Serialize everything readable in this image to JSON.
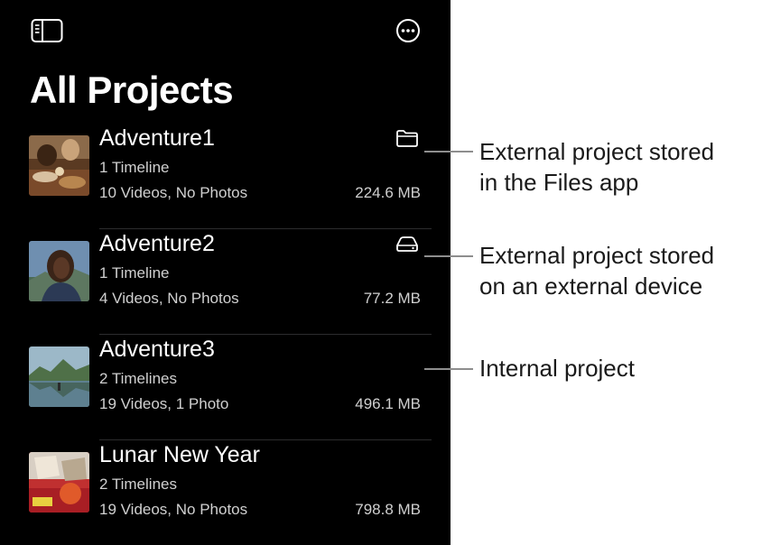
{
  "header": {
    "title": "All Projects",
    "sidebar_icon": "sidebar-toggle-icon",
    "more_icon": "ellipsis-circle-icon"
  },
  "projects": [
    {
      "name": "Adventure1",
      "timelines": "1 Timeline",
      "media": "10 Videos, No Photos",
      "size": "224.6 MB",
      "storage_icon": "folder-icon"
    },
    {
      "name": "Adventure2",
      "timelines": "1 Timeline",
      "media": "4 Videos, No Photos",
      "size": "77.2 MB",
      "storage_icon": "external-drive-icon"
    },
    {
      "name": "Adventure3",
      "timelines": "2 Timelines",
      "media": "19 Videos, 1 Photo",
      "size": "496.1 MB",
      "storage_icon": ""
    },
    {
      "name": "Lunar New Year",
      "timelines": "2 Timelines",
      "media": "19 Videos, No Photos",
      "size": "798.8 MB",
      "storage_icon": ""
    }
  ],
  "callouts": [
    {
      "line1": "External project stored",
      "line2": "in the Files app"
    },
    {
      "line1": "External project stored",
      "line2": "on an external device"
    },
    {
      "line1": "Internal project"
    }
  ],
  "colors": {
    "panel_background": "#000000",
    "page_background": "#ffffff",
    "text_primary": "#ffffff",
    "text_secondary": "#d0d0d0",
    "callout_line": "#8e8e8e"
  }
}
